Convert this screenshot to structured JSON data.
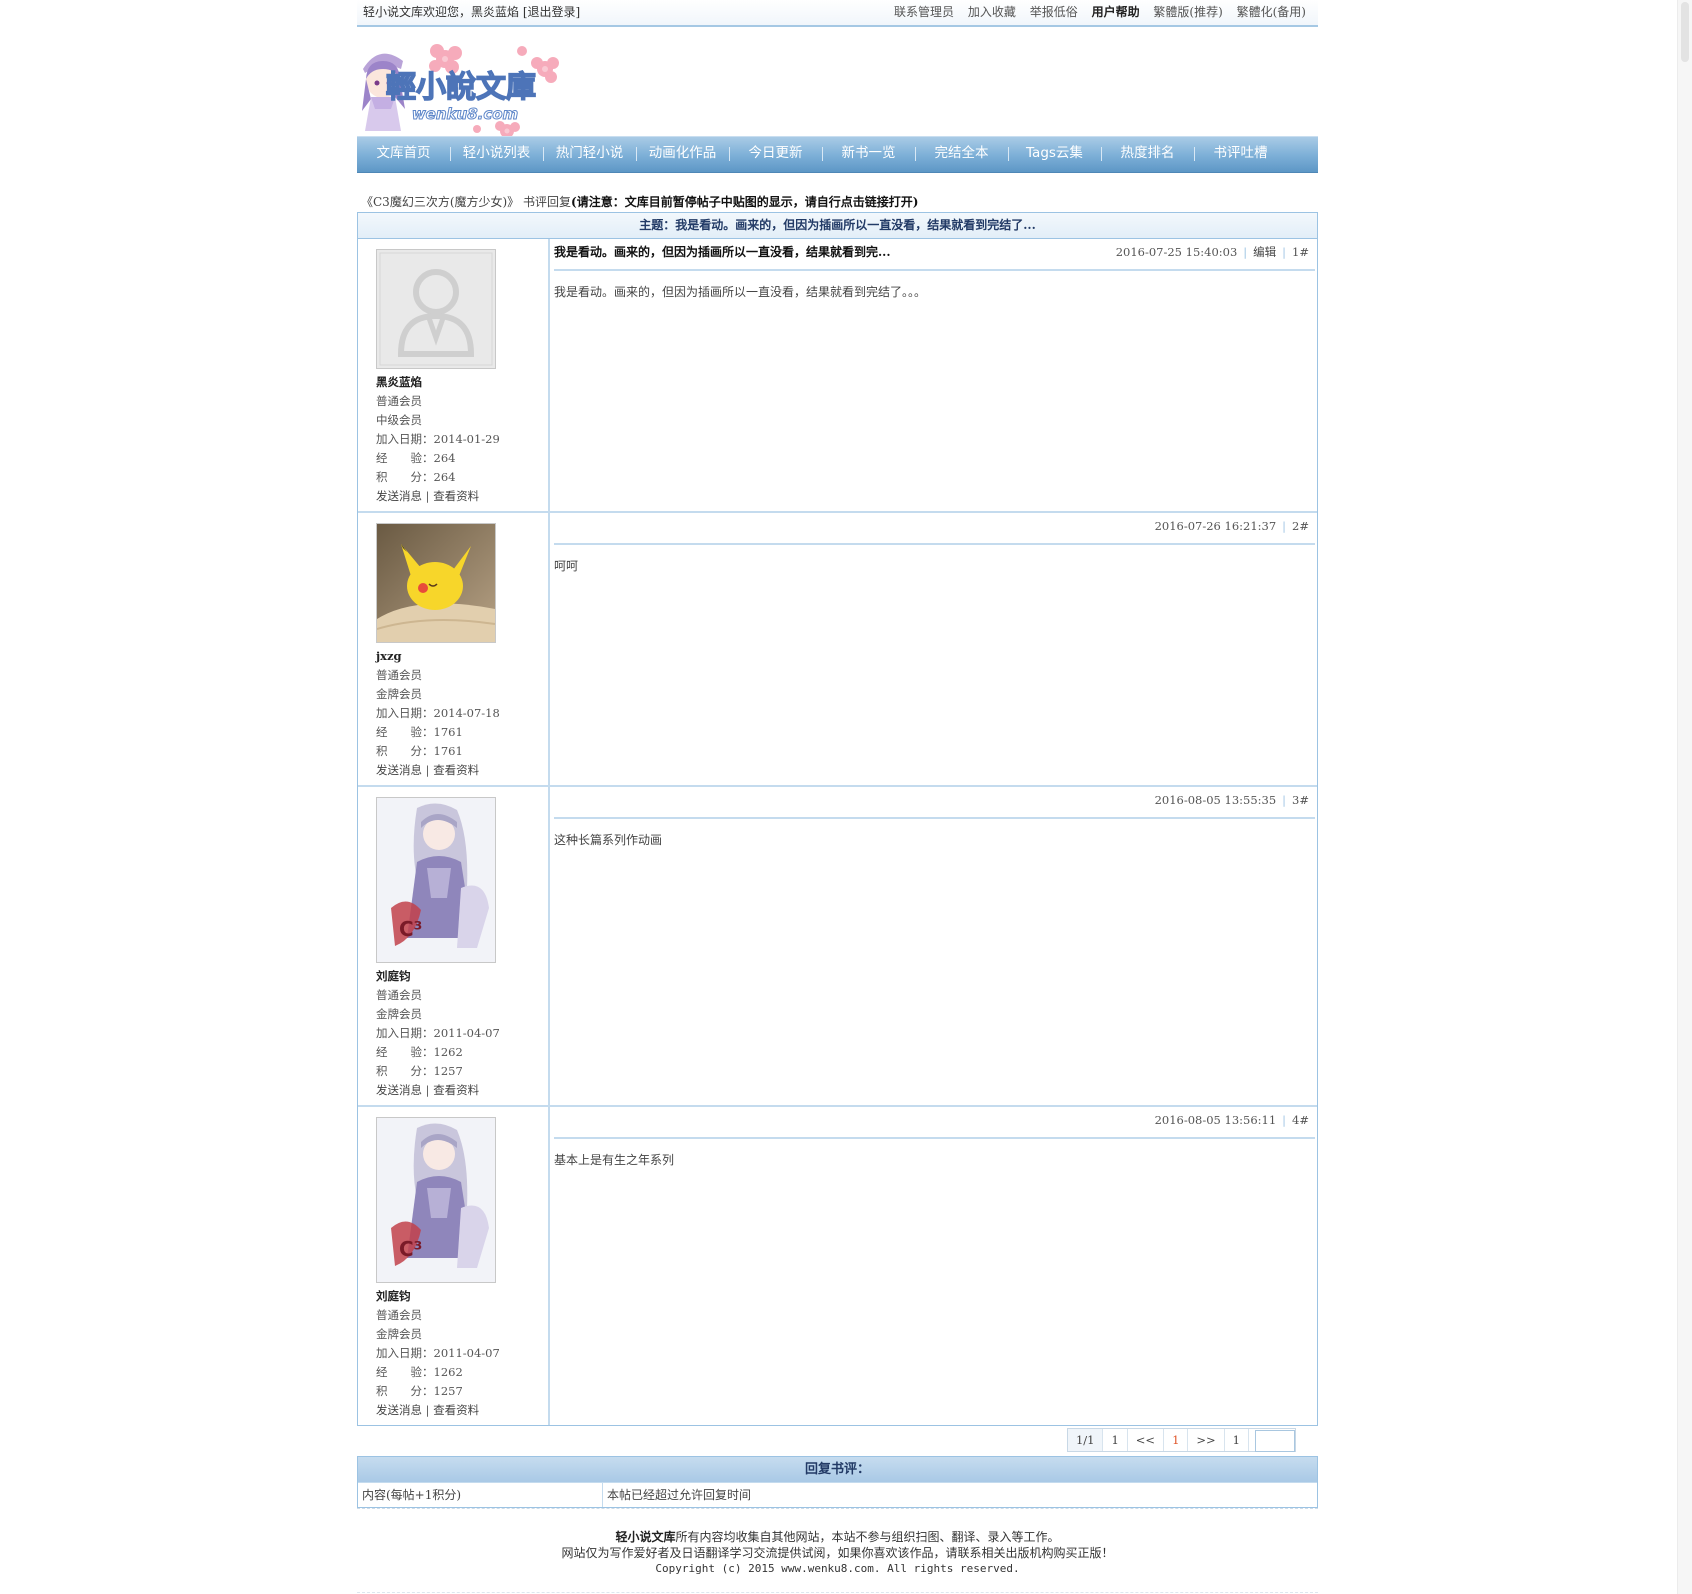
{
  "topbar": {
    "welcome": "轻小说文库欢迎您，黑炎蓝焰",
    "logout": "[退出登录]",
    "links": [
      "联系管理员",
      "加入收藏",
      "举报低俗",
      "用户帮助",
      "繁體版(推荐)",
      "繁體化(备用)"
    ]
  },
  "logo": {
    "text": "輕小說文庫",
    "domain": "wenku8.com"
  },
  "nav": [
    "文库首页",
    "轻小说列表",
    "热门轻小说",
    "动画化作品",
    "今日更新",
    "新书一览",
    "完结全本",
    "Tags云集",
    "热度排名",
    "书评吐槽"
  ],
  "breadcrumb": {
    "book": "《C3魔幻三次方(魔方少女)》",
    "section": "书评回复",
    "notice": "(请注意：文库目前暂停帖子中贴图的显示，请自行点击链接打开)"
  },
  "subject": "主题：我是看动。画来的，但因为插画所以一直没看，结果就看到完结了...",
  "labels": {
    "join": "加入日期：",
    "exp": "经　　验：",
    "score": "积　　分：",
    "send": "发送消息",
    "profile": "查看资料",
    "edit": "编辑"
  },
  "posts": [
    {
      "title": "我是看动。画来的，但因为插画所以一直没看，结果就看到完...",
      "time": "2016-07-25 15:40:03",
      "floor": "1#",
      "body": "我是看动。画来的，但因为插画所以一直没看，结果就看到完结了。。。",
      "user": {
        "name": "黑炎蓝焰",
        "role": "普通会员",
        "level": "中级会员",
        "join": "2014-01-29",
        "exp": "264",
        "score": "264"
      }
    },
    {
      "title": "",
      "time": "2016-07-26 16:21:37",
      "floor": "2#",
      "body": "呵呵",
      "user": {
        "name": "jxzg",
        "role": "普通会员",
        "level": "金牌会员",
        "join": "2014-07-18",
        "exp": "1761",
        "score": "1761"
      }
    },
    {
      "title": "",
      "time": "2016-08-05 13:55:35",
      "floor": "3#",
      "body": "这种长篇系列作动画",
      "user": {
        "name": "刘庭钧",
        "role": "普通会员",
        "level": "金牌会员",
        "join": "2011-04-07",
        "exp": "1262",
        "score": "1257"
      }
    },
    {
      "title": "",
      "time": "2016-08-05 13:56:11",
      "floor": "4#",
      "body": "基本上是有生之年系列",
      "user": {
        "name": "刘庭钧",
        "role": "普通会员",
        "level": "金牌会员",
        "join": "2011-04-07",
        "exp": "1262",
        "score": "1257"
      }
    }
  ],
  "pager": {
    "pages": "1/1",
    "first": "1",
    "prev": "<<",
    "current": "1",
    "next": ">>",
    "last": "1"
  },
  "reply": {
    "header": "回复书评：",
    "content_label": "内容(每帖+1积分)",
    "closed_notice": "本帖已经超过允许回复时间"
  },
  "footer": {
    "line1_bold": "轻小说文库",
    "line1": "所有内容均收集自其他网站，本站不参与组织扫图、翻译、录入等工作。",
    "line2": "网站仅为写作爱好者及日语翻译学习交流提供试阅，如果你喜欢该作品，请联系相关出版机构购买正版！",
    "line3": "Copyright (c) 2015 www.wenku8.com. All rights reserved."
  },
  "colors": {
    "nav": "#7fb1d8",
    "border": "#9cc3e3",
    "accent": "#e0552a"
  },
  "icons": {
    "default_avatar": "user-silhouette-icon"
  }
}
